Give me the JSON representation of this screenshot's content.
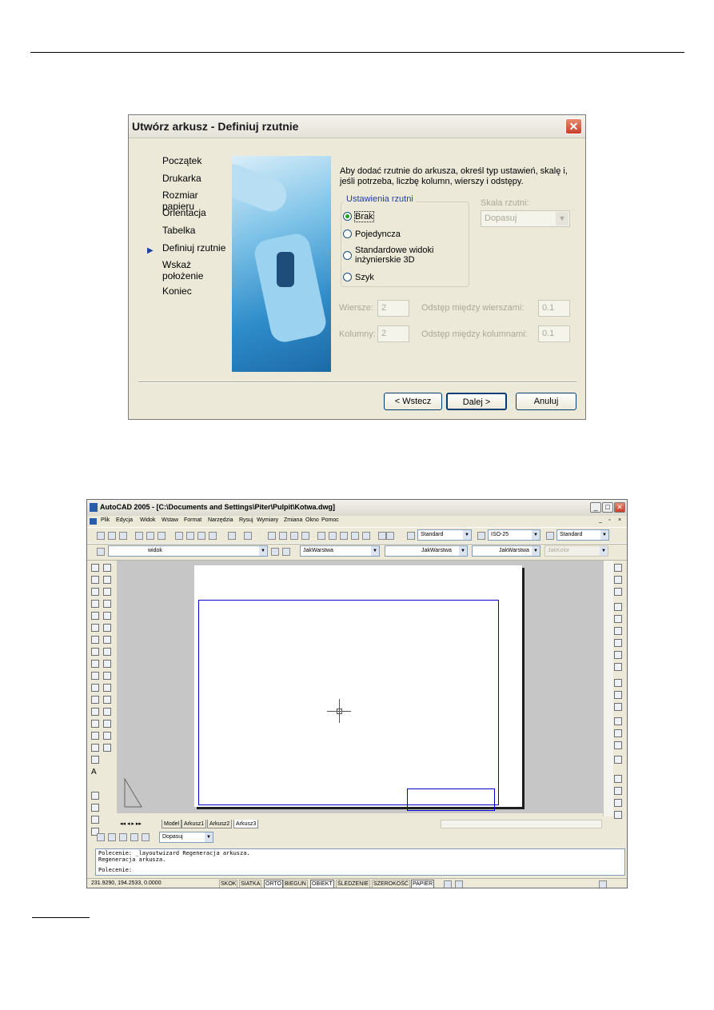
{
  "dialog": {
    "title": "Utwórz arkusz - Definiuj rzutnie",
    "close_label": "✕",
    "steps": [
      "Początek",
      "Drukarka",
      "Rozmiar papieru",
      "Orientacja",
      "Tabelka",
      "Definiuj rzutnie",
      "Wskaż położenie",
      "Koniec"
    ],
    "current_step_marker": "▶",
    "intro_text": "Aby dodać rzutnie do arkusza, określ typ ustawień, skalę i, jeśli potrzeba, liczbę kolumn, wierszy i odstępy.",
    "group_caption": "Ustawienia rzutni",
    "options": [
      "Brak",
      "Pojedyncza",
      "Standardowe widoki inżynierskie 3D",
      "Szyk"
    ],
    "selected_option": "Brak",
    "scale_label": "Skala rzutni:",
    "scale_value": "Dopasuj",
    "rows_label": "Wiersze:",
    "rows_value": "2",
    "row_spacing_label": "Odstęp między wierszami:",
    "row_spacing_value": "0.1",
    "cols_label": "Kolumny:",
    "cols_value": "2",
    "col_spacing_label": "Odstęp między kolumnami:",
    "col_spacing_value": "0.1",
    "back_button": "< Wstecz",
    "next_button": "Dalej >",
    "cancel_button": "Anuluj"
  },
  "acad": {
    "title": "AutoCAD 2005 - [C:\\Documents and Settings\\Piter\\Pulpit\\Kotwa.dwg]",
    "menu": [
      "Plik",
      "Edycja",
      "Widok",
      "Wstaw",
      "Format",
      "Narzędzia",
      "Rysuj",
      "Wymiary",
      "Zmiana",
      "Okno",
      "Pomoc"
    ],
    "text_style": "Standard",
    "dim_style": "ISO-25",
    "table_style": "Standard",
    "layer": "widok",
    "color": "JakWarstwa",
    "linetype": "JakWarstwa",
    "lineweight": "JakWarstwa",
    "plotstyle": "JakKolor",
    "tabs": [
      "Model",
      "Arkusz1",
      "Arkusz2",
      "Arkusz3"
    ],
    "active_tab": "Arkusz3",
    "viewport_scale": "Dopasuj",
    "command_lines": [
      "Polecenie: _layoutwizard Regeneracja arkusza.",
      "Regeneracja arkusza.",
      "Polecenie:"
    ],
    "coordinates": "231.9290, 194.2533, 0.0000",
    "status_buttons": [
      "SKOK",
      "SIATKA",
      "ORTO",
      "BIEGUN",
      "OBIEKT",
      "ŚLEDZENIE",
      "SZEROKOŚĆ",
      "PAPIER"
    ],
    "status_on": [
      "ORTO",
      "OBIEKT",
      "PAPIER"
    ]
  }
}
